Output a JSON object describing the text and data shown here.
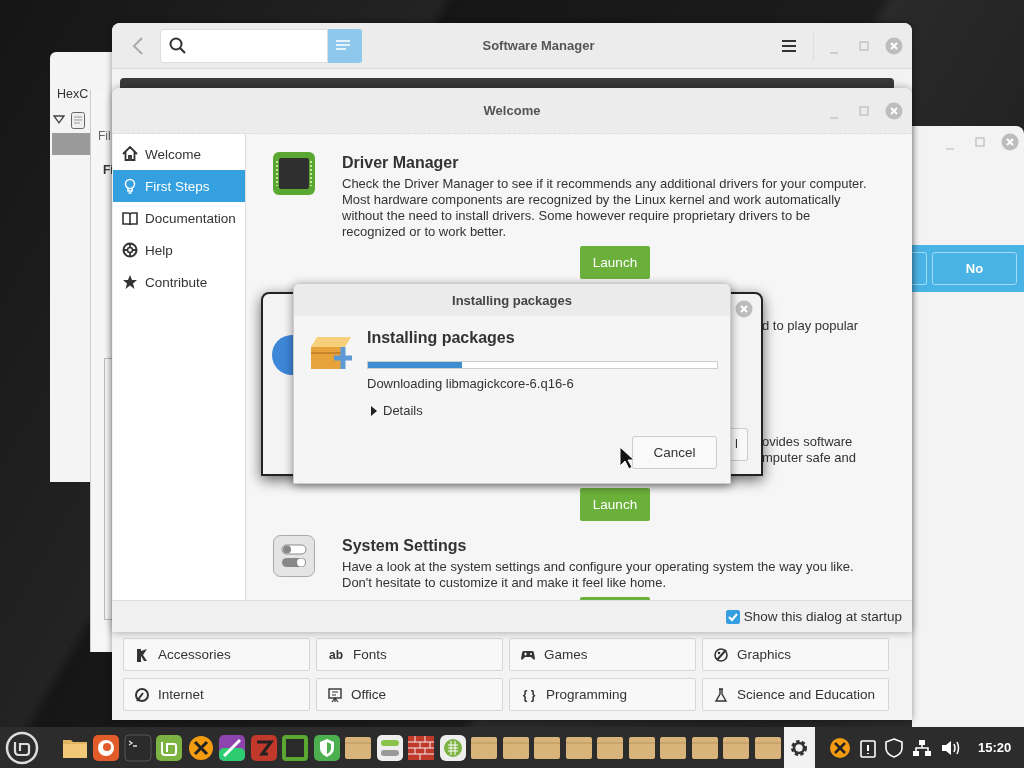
{
  "hexchat_window": {
    "title": "HexC"
  },
  "files_window": {
    "text_1": "Fil",
    "text_2": "Fi"
  },
  "right_window": {
    "button_1": "No"
  },
  "software_manager": {
    "title": "Software Manager",
    "categories": [
      {
        "kind": "accessories",
        "label": "Accessories"
      },
      {
        "kind": "fonts",
        "label": "Fonts",
        "icon_text": "ab"
      },
      {
        "kind": "games",
        "label": "Games"
      },
      {
        "kind": "graphics",
        "label": "Graphics"
      },
      {
        "kind": "internet",
        "label": "Internet"
      },
      {
        "kind": "office",
        "label": "Office"
      },
      {
        "kind": "programming",
        "label": "Programming",
        "icon_text": "{ }"
      },
      {
        "kind": "science",
        "label": "Science and Education"
      }
    ]
  },
  "welcome": {
    "title": "Welcome",
    "sidebar": [
      {
        "kind": "home",
        "label": "Welcome",
        "selected": false
      },
      {
        "kind": "bulb",
        "label": "First Steps",
        "selected": true
      },
      {
        "kind": "book",
        "label": "Documentation",
        "selected": false
      },
      {
        "kind": "help",
        "label": "Help",
        "selected": false
      },
      {
        "kind": "star",
        "label": "Contribute",
        "selected": false
      }
    ],
    "sections": [
      {
        "kind": "full",
        "title": "Driver Manager",
        "body": "Check the Driver Manager to see if it recommends any additional drivers for your computer. Most hardware components are recognized by the Linux kernel and work automatically without the need to install drivers. Some however require proprietary drivers to be recognized or to work better.",
        "button": "Launch"
      },
      {
        "kind": "fragment",
        "lines": [
          "d to play popular"
        ]
      },
      {
        "kind": "fragment",
        "lines": [
          "ovides software",
          "mputer safe and"
        ],
        "button": "Launch"
      },
      {
        "kind": "full",
        "title": "System Settings",
        "body": "Have a look at the system settings and configure your operating system the way you like. Don't hesitate to customize it and make it feel like home."
      }
    ],
    "startup_checkbox": {
      "label": "Show this dialog at startup",
      "checked": true
    }
  },
  "question_dialog": {
    "button_fragment": "l"
  },
  "install_dialog": {
    "title": "Installing packages",
    "heading": "Installing packages",
    "level": 0.27,
    "status": "Downloading libmagickcore-6.q16-6",
    "details": {
      "label": "Details",
      "expanded": false
    },
    "cancel": "Cancel"
  },
  "taskbar": {
    "apps": [
      {
        "kind": "folder",
        "active": false
      },
      {
        "kind": "browser",
        "active": false
      },
      {
        "kind": "terminal",
        "active": false
      },
      {
        "kind": "mint",
        "active": false
      },
      {
        "kind": "xcircle",
        "active": false
      },
      {
        "kind": "paint",
        "active": false
      },
      {
        "kind": "redapp",
        "active": false
      },
      {
        "kind": "chip",
        "active": false
      },
      {
        "kind": "shield",
        "active": false
      },
      {
        "kind": "package",
        "active": false
      },
      {
        "kind": "toggle",
        "active": false
      },
      {
        "kind": "brick",
        "active": false
      },
      {
        "kind": "globe",
        "active": false
      },
      {
        "kind": "package",
        "active": false
      },
      {
        "kind": "package",
        "active": false
      },
      {
        "kind": "package",
        "active": false
      },
      {
        "kind": "package",
        "active": false
      },
      {
        "kind": "package",
        "active": false
      },
      {
        "kind": "package",
        "active": false
      },
      {
        "kind": "package",
        "active": false
      },
      {
        "kind": "package",
        "active": false
      },
      {
        "kind": "package",
        "active": false
      },
      {
        "kind": "package",
        "active": false
      },
      {
        "kind": "gear",
        "active": true
      }
    ],
    "clock": "15:20"
  }
}
